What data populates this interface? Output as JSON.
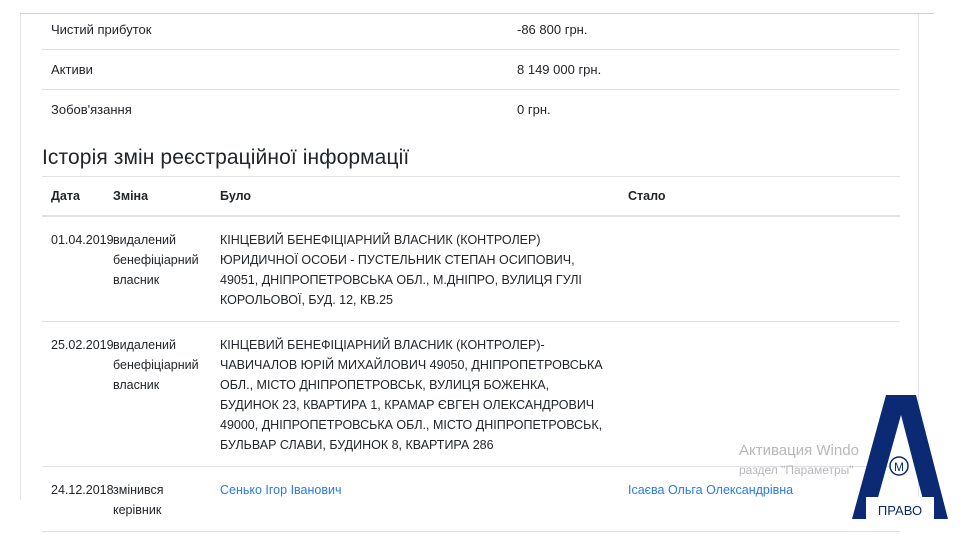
{
  "financials": [
    {
      "label": "Чистий прибуток",
      "value": "-86 800 грн."
    },
    {
      "label": "Активи",
      "value": "8 149 000 грн."
    },
    {
      "label": "Зобов'язання",
      "value": "0 грн."
    }
  ],
  "history": {
    "title": "Історія змін реєстраційної інформації",
    "columns": {
      "date": "Дата",
      "change": "Зміна",
      "was": "Було",
      "became": "Стало"
    },
    "rows": [
      {
        "date": "01.04.2019",
        "change": "видалений бенефіціарний власник",
        "was": "КІНЦЕВИЙ БЕНЕФІЦІАРНИЙ ВЛАСНИК (КОНТРОЛЕР) ЮРИДИЧНОЇ ОСОБИ - ПУСТЕЛЬНИК СТЕПАН ОСИПОВИЧ, 49051, ДНІПРОПЕТРОВСЬКА ОБЛ., М.ДНІПРО, ВУЛИЦЯ ГУЛІ КОРОЛЬОВОЇ, БУД. 12, КВ.25",
        "became": ""
      },
      {
        "date": "25.02.2019",
        "change": "видалений бенефіціарний власник",
        "was": "КІНЦЕВИЙ БЕНЕФІЦІАРНИЙ ВЛАСНИК (КОНТРОЛЕР)- ЧАВИЧАЛОВ ЮРІЙ МИХАЙЛОВИЧ 49050, ДНІПРОПЕТРОВСЬКА ОБЛ., МІСТО ДНІПРОПЕТРОВСЬК, ВУЛИЦЯ БОЖЕНКА, БУДИНОК 23, КВАРТИРА 1, КРАМАР ЄВГЕН ОЛЕКСАНДРОВИЧ 49000, ДНІПРОПЕТРОВСЬКА ОБЛ., МІСТО ДНІПРОПЕТРОВСЬК, БУЛЬВАР СЛАВИ, БУДИНОК 8, КВАРТИРА 286",
        "became": ""
      },
      {
        "date": "24.12.2018",
        "change": "змінився керівник",
        "was": "Сенько Ігор Іванович",
        "became": "Ісаєва Ольга Олександрівна"
      }
    ]
  },
  "watermark": {
    "line1": "Активация Windo",
    "line2": "раздел \"Параметры\""
  },
  "logo": {
    "text": "ПРАВО",
    "badge": "М",
    "color": "#0b2a73"
  }
}
